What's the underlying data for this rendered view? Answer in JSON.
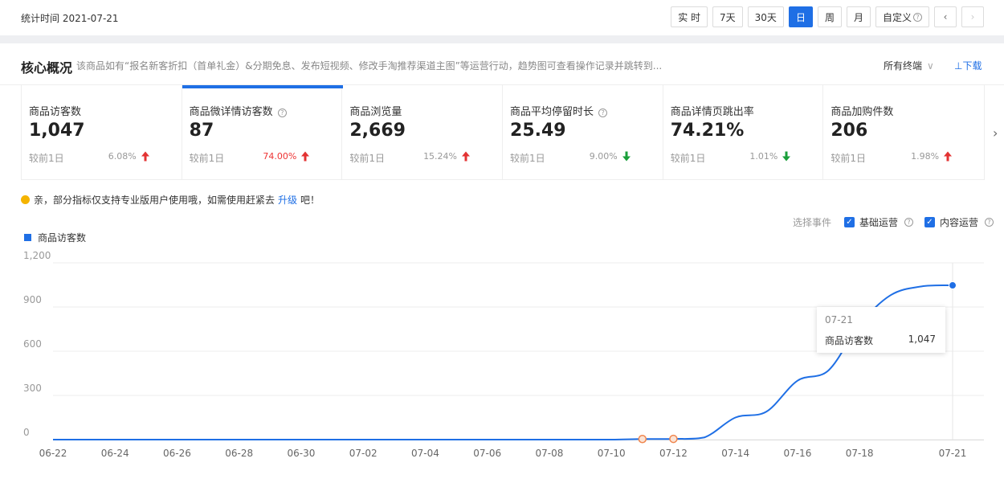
{
  "header": {
    "stat_time": "统计时间 2021-07-21",
    "periods": [
      "实 时",
      "7天",
      "30天",
      "日",
      "周",
      "月"
    ],
    "active_period": "日",
    "custom_label": "自定义"
  },
  "core": {
    "title": "核心概况",
    "description": "该商品如有“报名新客折扣（首单礼金）&分期免息、发布短视频、修改手淘推荐渠道主图”等运营行动，趋势图可查看操作记录并跳转到...",
    "terminal": "所有终端",
    "download": "⊥下载"
  },
  "metrics": [
    {
      "label": "商品访客数",
      "value": "1,047",
      "compare": "较前1日",
      "pct": "6.08%",
      "dir": "up",
      "highlight": false,
      "help": false
    },
    {
      "label": "商品微详情访客数",
      "value": "87",
      "compare": "较前1日",
      "pct": "74.00%",
      "dir": "up",
      "highlight": true,
      "help": true
    },
    {
      "label": "商品浏览量",
      "value": "2,669",
      "compare": "较前1日",
      "pct": "15.24%",
      "dir": "up",
      "highlight": false,
      "help": false
    },
    {
      "label": "商品平均停留时长",
      "value": "25.49",
      "compare": "较前1日",
      "pct": "9.00%",
      "dir": "down",
      "highlight": false,
      "help": true
    },
    {
      "label": "商品详情页跳出率",
      "value": "74.21%",
      "compare": "较前1日",
      "pct": "1.01%",
      "dir": "down",
      "highlight": false,
      "help": false
    },
    {
      "label": "商品加购件数",
      "value": "206",
      "compare": "较前1日",
      "pct": "1.98%",
      "dir": "up",
      "highlight": false,
      "help": false
    }
  ],
  "notice": {
    "text1": "亲，部分指标仅支持专业版用户使用哦，如需使用赶紧去",
    "link": "升级",
    "text2": "吧！"
  },
  "events": {
    "label": "选择事件",
    "items": [
      "基础运营",
      "内容运营"
    ]
  },
  "legend": {
    "name": "商品访客数"
  },
  "tooltip": {
    "date": "07-21",
    "name": "商品访客数",
    "value": "1,047"
  },
  "colors": {
    "accent": "#1f6fe5",
    "up": "#e33333",
    "down": "#1a9f3a",
    "marker": "#f0874f"
  },
  "chart_data": {
    "type": "line",
    "x": [
      "06-22",
      "06-23",
      "06-24",
      "06-25",
      "06-26",
      "06-27",
      "06-28",
      "06-29",
      "06-30",
      "07-01",
      "07-02",
      "07-03",
      "07-04",
      "07-05",
      "07-06",
      "07-07",
      "07-08",
      "07-09",
      "07-10",
      "07-11",
      "07-12",
      "07-13",
      "07-14",
      "07-15",
      "07-16",
      "07-17",
      "07-18",
      "07-19",
      "07-20",
      "07-21"
    ],
    "x_tick_labels": [
      "06-22",
      "06-24",
      "06-26",
      "06-28",
      "06-30",
      "07-02",
      "07-04",
      "07-06",
      "07-08",
      "07-10",
      "07-12",
      "07-14",
      "07-16",
      "07-18",
      "07-21"
    ],
    "series": [
      {
        "name": "商品访客数",
        "values": [
          0,
          0,
          0,
          0,
          0,
          0,
          0,
          0,
          0,
          0,
          0,
          0,
          0,
          0,
          0,
          0,
          0,
          0,
          0,
          4,
          5,
          15,
          150,
          190,
          400,
          470,
          780,
          980,
          1040,
          1047
        ]
      }
    ],
    "event_markers": [
      "07-11",
      "07-12"
    ],
    "y_ticks": [
      0,
      300,
      600,
      900,
      1200
    ],
    "ylim": [
      0,
      1200
    ],
    "grid": true
  }
}
